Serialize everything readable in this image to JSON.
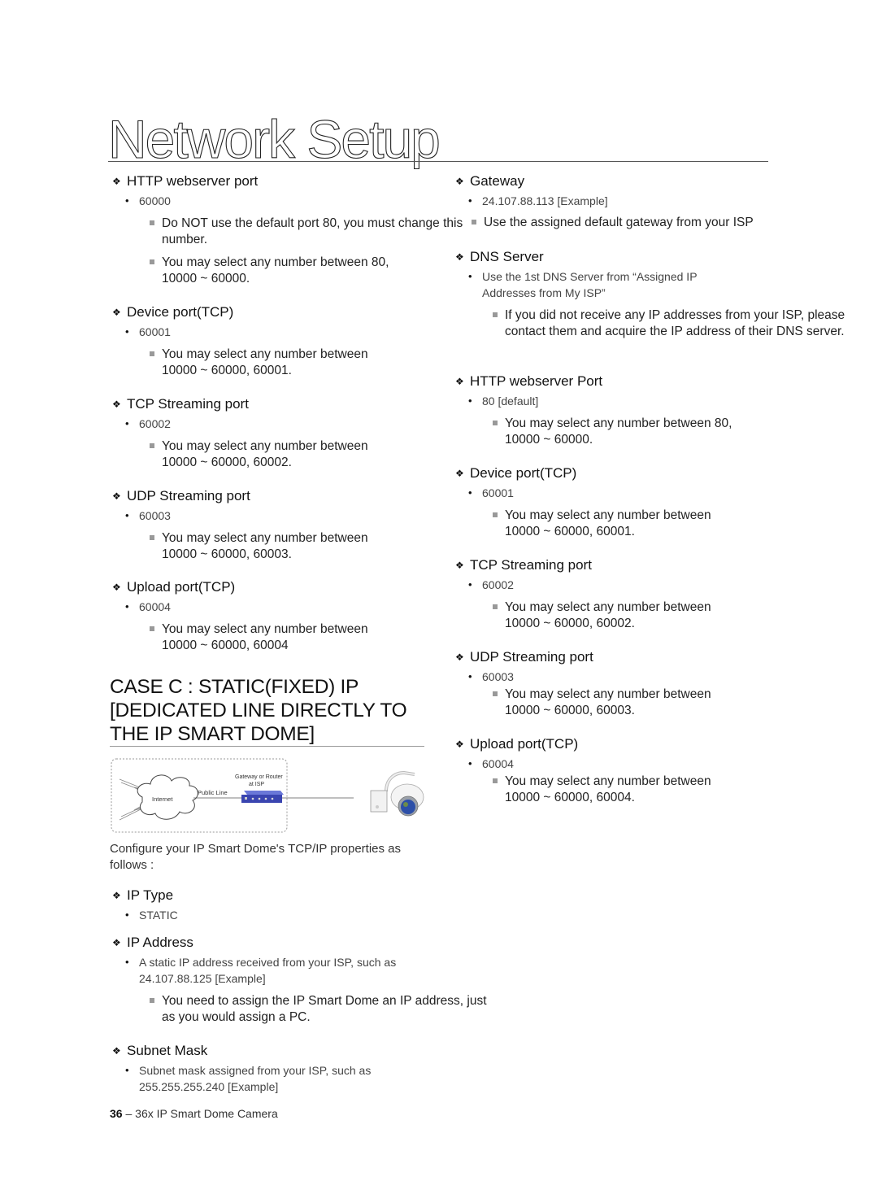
{
  "page": {
    "title": "Network Setup",
    "footer": {
      "page_number": "36",
      "separator": " – ",
      "doc_title": "36x IP Smart Dome Camera"
    }
  },
  "left_column": {
    "http_webserver": {
      "heading": "HTTP webserver port",
      "value": "60000",
      "notes": [
        "Do NOT use the default port 80, you must change this number.",
        "You may select any number between 80, 10000 ~ 60000."
      ]
    },
    "device_port": {
      "heading": "Device port(TCP)",
      "value": "60001",
      "notes": [
        "You may select any number between 10000 ~ 60000, 60001."
      ]
    },
    "tcp_streaming": {
      "heading": "TCP Streaming port",
      "value": "60002",
      "notes": [
        "You may select any number between 10000 ~ 60000, 60002."
      ]
    },
    "udp_streaming": {
      "heading": "UDP Streaming port",
      "value": "60003",
      "notes": [
        "You may select any number between 10000 ~ 60000, 60003."
      ]
    },
    "upload_port": {
      "heading": "Upload port(TCP)",
      "value": "60004",
      "notes": [
        "You may select any number between 10000 ~ 60000, 60004"
      ]
    },
    "case_heading": "CASE C : STATIC(FIXED) IP [DEDICATED LINE DIRECTLY TO THE IP SMART DOME]",
    "diagram": {
      "internet_label": "Internet",
      "public_line_label": "Public Line",
      "gateway_label_1": "Gateway or Router",
      "gateway_label_2": "at ISP"
    },
    "intro": "Configure your IP Smart Dome's TCP/IP properties as follows :",
    "ip_type": {
      "heading": "IP Type",
      "value": "STATIC"
    },
    "ip_address": {
      "heading": "IP Address",
      "value": "A static IP address received from your ISP, such as 24.107.88.125 [Example]",
      "notes": [
        "You need to assign the IP Smart Dome an IP address, just as you would assign a PC."
      ]
    },
    "subnet_mask": {
      "heading": "Subnet Mask",
      "value": "Subnet mask assigned from your ISP, such as 255.255.255.240 [Example]"
    }
  },
  "right_column": {
    "gateway": {
      "heading": "Gateway",
      "value": "24.107.88.113 [Example]",
      "notes": [
        "Use the assigned default gateway from your ISP"
      ]
    },
    "dns_server": {
      "heading": "DNS Server",
      "value": "Use the 1st DNS Server from “Assigned IP Addresses from My ISP”",
      "notes": [
        "If you did not receive any IP addresses from your ISP, please contact them and acquire the IP address of their DNS server."
      ]
    },
    "http_webserver": {
      "heading": "HTTP webserver Port",
      "value": "80 [default]",
      "notes": [
        "You may select any number between 80, 10000 ~ 60000."
      ]
    },
    "device_port": {
      "heading": "Device port(TCP)",
      "value": "60001",
      "notes": [
        "You may select any number between 10000 ~ 60000, 60001."
      ]
    },
    "tcp_streaming": {
      "heading": "TCP Streaming port",
      "value": "60002",
      "notes": [
        "You may select any number between 10000 ~ 60000, 60002."
      ]
    },
    "udp_streaming": {
      "heading": "UDP Streaming port",
      "value": "60003",
      "notes": [
        "You may select any number between 10000 ~ 60000, 60003."
      ]
    },
    "upload_port": {
      "heading": "Upload port(TCP)",
      "value": "60004",
      "notes": [
        "You may select any number between 10000 ~ 60000, 60004."
      ]
    }
  }
}
